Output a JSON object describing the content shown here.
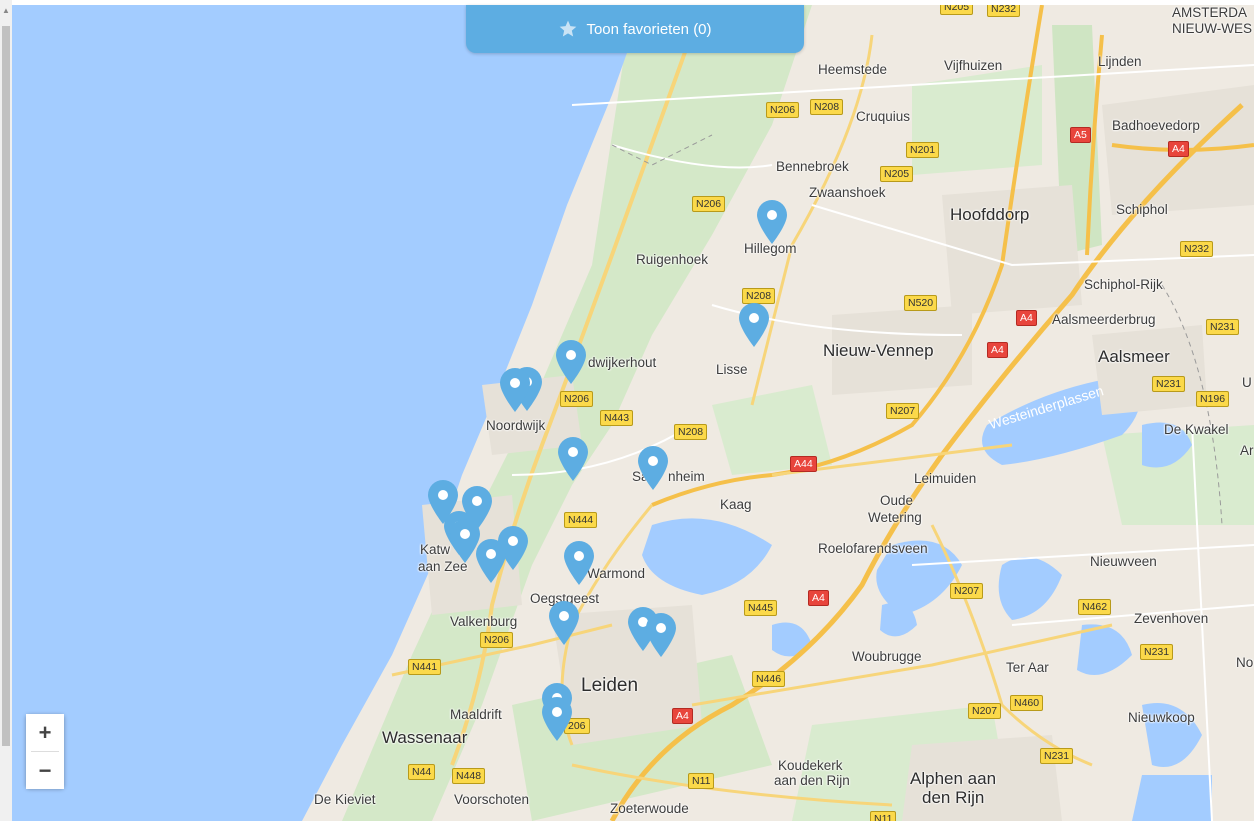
{
  "favorites_button": {
    "label": "Toon favorieten (0)",
    "icon": "star-icon"
  },
  "zoom": {
    "in_label": "+",
    "out_label": "−"
  },
  "colors": {
    "sea": "#a3ccff",
    "land": "#efeae2",
    "pin": "#5dade2",
    "highway_label": "#e8453c",
    "road_label": "#fbd94a"
  },
  "places": [
    {
      "name": "AMSTERDA",
      "cls": "",
      "key": "amsterdam"
    },
    {
      "name": "NIEUW-WES",
      "cls": "",
      "key": "nieuw-west"
    },
    {
      "name": "Heemstede",
      "cls": "",
      "key": "heemstede"
    },
    {
      "name": "Vijfhuizen",
      "cls": "",
      "key": "vijfhuizen"
    },
    {
      "name": "Lijnden",
      "cls": "",
      "key": "lijnden"
    },
    {
      "name": "Cruquius",
      "cls": "",
      "key": "cruquius"
    },
    {
      "name": "Badhoevedorp",
      "cls": "",
      "key": "badhoevedorp"
    },
    {
      "name": "Bennebroek",
      "cls": "",
      "key": "bennebroek"
    },
    {
      "name": "Zwaanshoek",
      "cls": "",
      "key": "zwaanshoek"
    },
    {
      "name": "Hoofddorp",
      "cls": "big",
      "key": "hoofddorp"
    },
    {
      "name": "Schiphol",
      "cls": "",
      "key": "schiphol"
    },
    {
      "name": "Hillegom",
      "cls": "",
      "key": "hillegom"
    },
    {
      "name": "Ruigenhoek",
      "cls": "",
      "key": "ruigenhoek"
    },
    {
      "name": "Schiphol-Rijk",
      "cls": "",
      "key": "schiphol-rijk"
    },
    {
      "name": "Aalsmeerderbrug",
      "cls": "",
      "key": "aalsmeerderbrug"
    },
    {
      "name": "Nieuw-Vennep",
      "cls": "big",
      "key": "nieuw-vennep"
    },
    {
      "name": "Aalsmeer",
      "cls": "big",
      "key": "aalsmeer"
    },
    {
      "name": "dwijkerhout",
      "cls": "",
      "key": "noordwijkerhout"
    },
    {
      "name": "Lisse",
      "cls": "",
      "key": "lisse"
    },
    {
      "name": "Noordwijk",
      "cls": "",
      "key": "noordwijk"
    },
    {
      "name": "De Kwakel",
      "cls": "",
      "key": "de-kwakel"
    },
    {
      "name": "Sas",
      "cls": "",
      "key": "sassenheim-a"
    },
    {
      "name": "nheim",
      "cls": "",
      "key": "sassenheim-b"
    },
    {
      "name": "Leimuiden",
      "cls": "",
      "key": "leimuiden"
    },
    {
      "name": "Kaag",
      "cls": "",
      "key": "kaag"
    },
    {
      "name": "Oude",
      "cls": "",
      "key": "oude"
    },
    {
      "name": "Wetering",
      "cls": "",
      "key": "wetering"
    },
    {
      "name": "Katw",
      "cls": "",
      "key": "katwijk-a"
    },
    {
      "name": "aan Zee",
      "cls": "",
      "key": "katwijk-b"
    },
    {
      "name": "Roelofarendsveen",
      "cls": "",
      "key": "roelofarendsveen"
    },
    {
      "name": "Nieuwveen",
      "cls": "",
      "key": "nieuwveen"
    },
    {
      "name": "Warmond",
      "cls": "",
      "key": "warmond"
    },
    {
      "name": "Oegstgeest",
      "cls": "",
      "key": "oegstgeest"
    },
    {
      "name": "Zevenhoven",
      "cls": "",
      "key": "zevenhoven"
    },
    {
      "name": "Valkenburg",
      "cls": "",
      "key": "valkenburg"
    },
    {
      "name": "Woubrugge",
      "cls": "",
      "key": "woubrugge"
    },
    {
      "name": "Ter Aar",
      "cls": "",
      "key": "ter-aar"
    },
    {
      "name": "No",
      "cls": "",
      "key": "no"
    },
    {
      "name": "Leiden",
      "cls": "xl",
      "key": "leiden"
    },
    {
      "name": "Maaldrift",
      "cls": "",
      "key": "maaldrift"
    },
    {
      "name": "Nieuwkoop",
      "cls": "",
      "key": "nieuwkoop"
    },
    {
      "name": "Wassenaar",
      "cls": "",
      "key": "wassenaar"
    },
    {
      "name": "Koudekerk",
      "cls": "",
      "key": "koudekerk-a"
    },
    {
      "name": "aan den Rijn",
      "cls": "",
      "key": "koudekerk-b"
    },
    {
      "name": "Alphen aan",
      "cls": "big",
      "key": "alphen-a"
    },
    {
      "name": "den Rijn",
      "cls": "big",
      "key": "alphen-b"
    },
    {
      "name": "De Kieviet",
      "cls": "",
      "key": "de-kieviet"
    },
    {
      "name": "Voorschoten",
      "cls": "",
      "key": "voorschoten"
    },
    {
      "name": "Zoeterwoude",
      "cls": "",
      "key": "zoeterwoude"
    },
    {
      "name": "U",
      "cls": "",
      "key": "u"
    },
    {
      "name": "Ar",
      "cls": "",
      "key": "ar"
    }
  ],
  "water_labels": [
    {
      "name": "Westeinderplassen",
      "key": "westeinderplassen"
    }
  ],
  "road_labels": [
    {
      "text": "N205",
      "key": "r1"
    },
    {
      "text": "N232",
      "key": "r2"
    },
    {
      "text": "N206",
      "key": "r3"
    },
    {
      "text": "N208",
      "key": "r4"
    },
    {
      "text": "A5",
      "key": "r5",
      "red": true
    },
    {
      "text": "A4",
      "key": "r6",
      "red": true
    },
    {
      "text": "N201",
      "key": "r7"
    },
    {
      "text": "N205",
      "key": "r8"
    },
    {
      "text": "N206",
      "key": "r9"
    },
    {
      "text": "N232",
      "key": "r10"
    },
    {
      "text": "N208",
      "key": "r11"
    },
    {
      "text": "N520",
      "key": "r12"
    },
    {
      "text": "A4",
      "key": "r13",
      "red": true
    },
    {
      "text": "A4",
      "key": "r14",
      "red": true
    },
    {
      "text": "N231",
      "key": "r15"
    },
    {
      "text": "N231",
      "key": "r16"
    },
    {
      "text": "N196",
      "key": "r17"
    },
    {
      "text": "N206",
      "key": "r18"
    },
    {
      "text": "N443",
      "key": "r19"
    },
    {
      "text": "N208",
      "key": "r20"
    },
    {
      "text": "N207",
      "key": "r21"
    },
    {
      "text": "A44",
      "key": "r22",
      "red": true
    },
    {
      "text": "N444",
      "key": "r23"
    },
    {
      "text": "N207",
      "key": "r24"
    },
    {
      "text": "A4",
      "key": "r25",
      "red": true
    },
    {
      "text": "N445",
      "key": "r26"
    },
    {
      "text": "N462",
      "key": "r27"
    },
    {
      "text": "N206",
      "key": "r28"
    },
    {
      "text": "N441",
      "key": "r29"
    },
    {
      "text": "N231",
      "key": "r30"
    },
    {
      "text": "N446",
      "key": "r31"
    },
    {
      "text": "N460",
      "key": "r32"
    },
    {
      "text": "N207",
      "key": "r33"
    },
    {
      "text": "A4",
      "key": "r34",
      "red": true
    },
    {
      "text": "206",
      "key": "r35"
    },
    {
      "text": "N231",
      "key": "r36"
    },
    {
      "text": "N44",
      "key": "r37"
    },
    {
      "text": "N448",
      "key": "r38"
    },
    {
      "text": "N11",
      "key": "r39"
    },
    {
      "text": "N11",
      "key": "r40"
    }
  ],
  "markers": [
    {
      "key": "hillegom"
    },
    {
      "key": "lisse"
    },
    {
      "key": "noordwijkerhout"
    },
    {
      "key": "noordwijk-1"
    },
    {
      "key": "noordwijk-2"
    },
    {
      "key": "voorhout"
    },
    {
      "key": "sassenheim"
    },
    {
      "key": "katwijk-1"
    },
    {
      "key": "katwijk-2"
    },
    {
      "key": "katwijk-3"
    },
    {
      "key": "katwijk-4"
    },
    {
      "key": "rijnsburg-1"
    },
    {
      "key": "rijnsburg-2"
    },
    {
      "key": "warmond"
    },
    {
      "key": "oegstgeest"
    },
    {
      "key": "leiden-east-1"
    },
    {
      "key": "leiden-east-2"
    },
    {
      "key": "leiden-south-1"
    },
    {
      "key": "leiden-south-2"
    }
  ]
}
